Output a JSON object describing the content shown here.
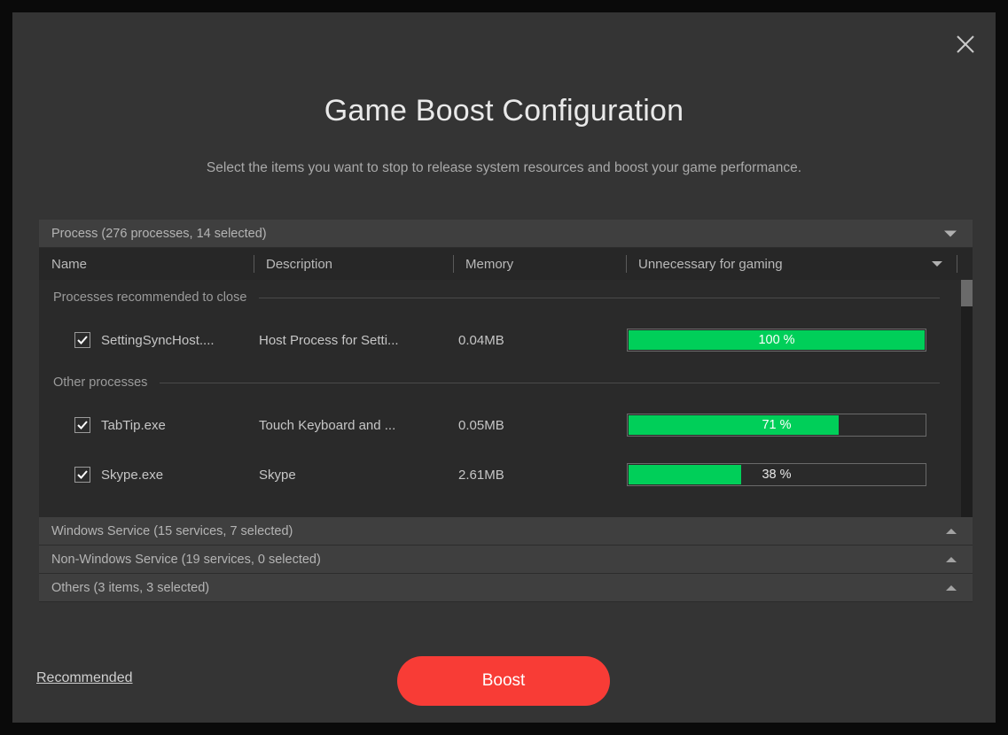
{
  "window": {
    "title": "Game Boost Configuration",
    "subtitle": "Select the items you want to stop to release system resources and boost your game performance.",
    "close_icon": "close-icon",
    "accent_red": "#f83c36",
    "accent_green": "#00cf59",
    "background": "#343434"
  },
  "panel": {
    "process_section": {
      "header_label": "Process (276 processes, 14 selected)",
      "expanded": true,
      "arrow_icon": "chevron-down-icon",
      "columns": [
        {
          "key": "name",
          "label": "Name"
        },
        {
          "key": "description",
          "label": "Description"
        },
        {
          "key": "memory",
          "label": "Memory"
        },
        {
          "key": "unnecessary",
          "label": "Unnecessary for gaming"
        }
      ],
      "sort_arrow_icon": "chevron-down-icon",
      "groups": [
        {
          "label": "Processes recommended to close",
          "rows": [
            {
              "checked": true,
              "name": "SettingSyncHost....",
              "description": "Host Process for Setti...",
              "memory": "0.04MB",
              "percent": 100,
              "percent_label": "100 %"
            }
          ]
        },
        {
          "label": "Other processes",
          "rows": [
            {
              "checked": true,
              "name": "TabTip.exe",
              "description": "Touch Keyboard and ...",
              "memory": "0.05MB",
              "percent": 71,
              "percent_label": "71 %"
            },
            {
              "checked": true,
              "name": "Skype.exe",
              "description": "Skype",
              "memory": "2.61MB",
              "percent": 38,
              "percent_label": "38 %"
            }
          ]
        }
      ]
    },
    "collapsed_sections": [
      {
        "label": "Windows Service (15 services, 7 selected)",
        "expanded": false,
        "arrow_icon": "chevron-up-icon"
      },
      {
        "label": "Non-Windows Service (19 services, 0 selected)",
        "expanded": false,
        "arrow_icon": "chevron-up-icon"
      },
      {
        "label": "Others (3 items, 3 selected)",
        "expanded": false,
        "arrow_icon": "chevron-up-icon"
      }
    ]
  },
  "footer": {
    "recommended_label": "Recommended",
    "boost_label": "Boost"
  }
}
